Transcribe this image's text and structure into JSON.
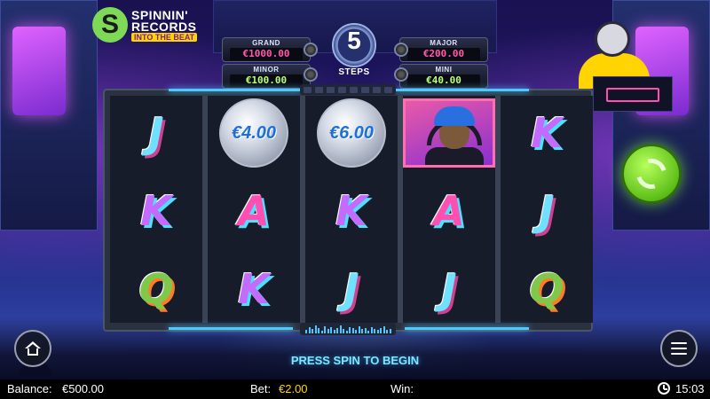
{
  "game": {
    "brand_line1": "SPINNIN'",
    "brand_line2": "RECORDS",
    "brand_tag": "INTO THE BEAT",
    "brand_letter": "S"
  },
  "jackpots": {
    "grand": {
      "label": "GRAND",
      "value": "€1000.00"
    },
    "major": {
      "label": "MAJOR",
      "value": "€200.00"
    },
    "minor": {
      "label": "MINOR",
      "value": "€100.00"
    },
    "mini": {
      "label": "MINI",
      "value": "€40.00"
    }
  },
  "steps": {
    "count": "5",
    "label": "STEPS"
  },
  "reels": [
    [
      {
        "type": "letter",
        "text": "J"
      },
      {
        "type": "letter",
        "text": "K"
      },
      {
        "type": "letter",
        "text": "Q"
      }
    ],
    [
      {
        "type": "coin",
        "text": "€4.00"
      },
      {
        "type": "letter",
        "text": "A"
      },
      {
        "type": "letter",
        "text": "K"
      }
    ],
    [
      {
        "type": "coin",
        "text": "€6.00"
      },
      {
        "type": "letter",
        "text": "K"
      },
      {
        "type": "letter",
        "text": "J"
      }
    ],
    [
      {
        "type": "wild",
        "text": ""
      },
      {
        "type": "letter",
        "text": "A"
      },
      {
        "type": "letter",
        "text": "J"
      }
    ],
    [
      {
        "type": "letter",
        "text": "K"
      },
      {
        "type": "letter",
        "text": "J"
      },
      {
        "type": "letter",
        "text": "Q"
      }
    ]
  ],
  "prompt": "PRESS SPIN TO BEGIN",
  "status": {
    "balance_label": "Balance:",
    "balance_value": "€500.00",
    "bet_label": "Bet:",
    "bet_value": "€2.00",
    "win_label": "Win:",
    "win_value": "",
    "time": "15:03"
  },
  "controls": {
    "spin_icon": "refresh-arrows-icon",
    "home_icon": "home-icon",
    "menu_icon": "hamburger-menu-icon"
  },
  "colors": {
    "spin_green": "#5fbf1a",
    "prompt_cyan": "#7de8ff",
    "bet_yellow": "#ffd400"
  }
}
